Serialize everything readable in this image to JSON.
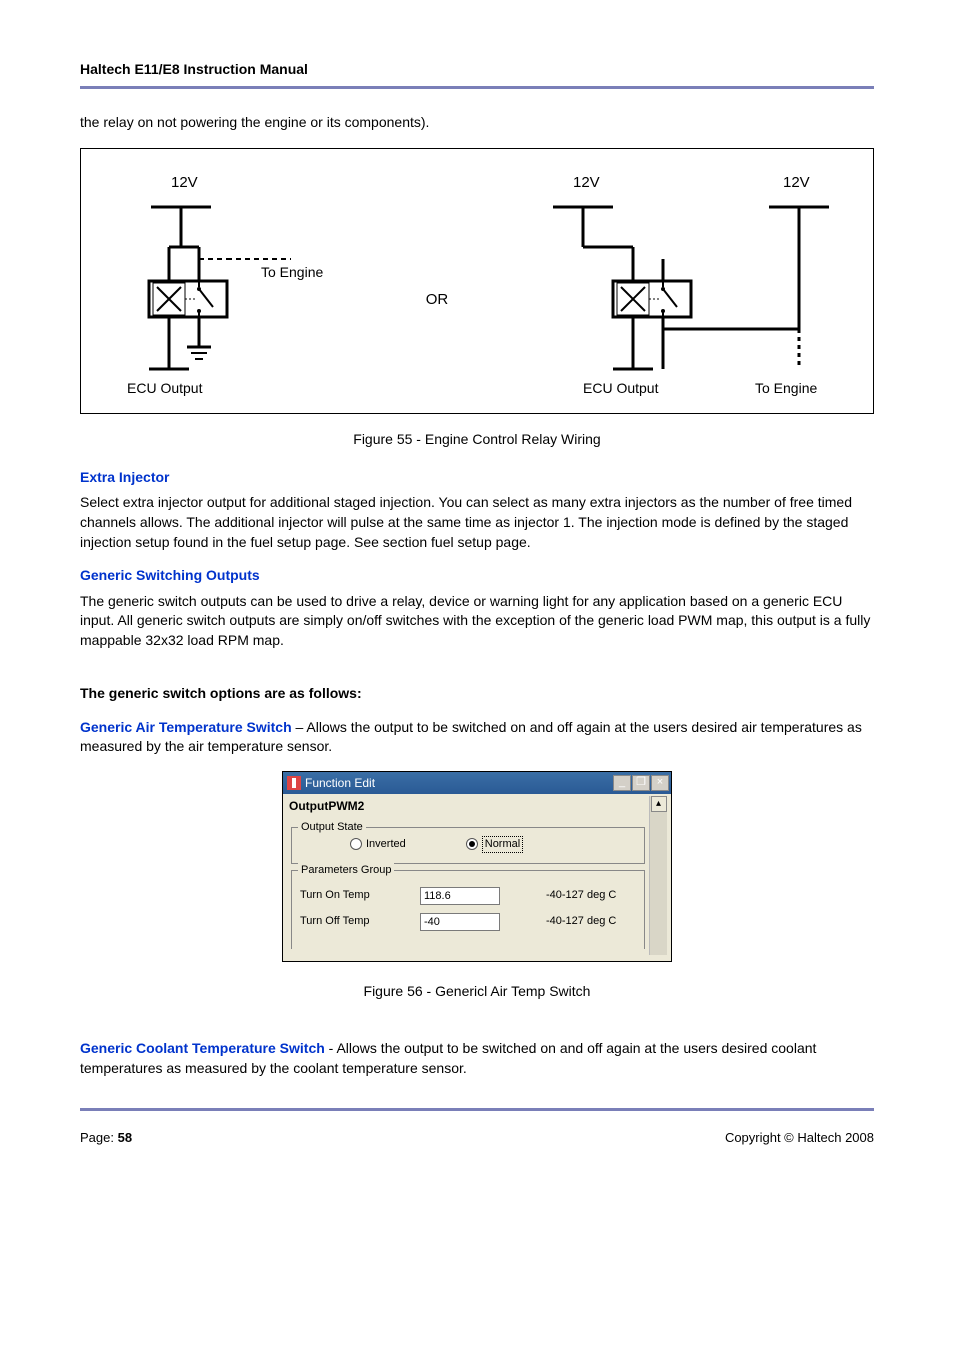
{
  "header": {
    "title": "Haltech E11/E8 Instruction Manual"
  },
  "intro_cont": "the relay on not powering the engine or its components).",
  "diagram": {
    "v12_a": "12V",
    "v12_b": "12V",
    "v12_c": "12V",
    "to_engine": "To Engine",
    "or": "OR",
    "ecu_out_a": "ECU Output",
    "ecu_out_b": "ECU Output",
    "to_engine_b": "To Engine"
  },
  "fig55": "Figure 55 - Engine Control Relay Wiring",
  "extra_injector": {
    "heading": "Extra Injector",
    "text": "Select extra injector output for additional staged injection. You can select as many extra injectors as the number of free timed channels allows. The additional injector will pulse at the same time as injector 1. The injection mode is defined by the staged injection setup found in the fuel setup page. See section  fuel setup page."
  },
  "generic_switching": {
    "heading": "Generic Switching Outputs",
    "text": "The generic switch outputs can be used to drive a relay, device or warning light for any application based on a generic ECU input. All generic switch outputs are simply on/off switches with the exception of the generic load PWM map, this output is a fully mappable 32x32 load RPM map."
  },
  "options_intro": "The generic switch options are as follows:",
  "generic_air": {
    "heading": "Generic Air Temperature Switch",
    "text": " – Allows the output to be switched on and off again at the users desired air temperatures as measured by the air temperature sensor."
  },
  "dialog": {
    "title": "Function Edit",
    "min": "_",
    "restore": "❐",
    "close": "×",
    "subheader": "OutputPWM2",
    "scroll_up": "▴",
    "output_state": {
      "legend": "Output State",
      "inverted": "Inverted",
      "normal": "Normal",
      "selected": "normal"
    },
    "params": {
      "legend": "Parameters Group",
      "rows": [
        {
          "label": "Turn On Temp",
          "value": "118.6",
          "range": "-40-127 deg C"
        },
        {
          "label": "Turn Off Temp",
          "value": "-40",
          "range": "-40-127 deg C"
        }
      ]
    }
  },
  "fig56": "Figure 56 - Genericl Air Temp Switch",
  "generic_coolant": {
    "heading": "Generic Coolant Temperature Switch",
    "text": " - Allows the output to be switched on and off again at the users desired coolant temperatures as measured by the coolant temperature sensor."
  },
  "footer": {
    "page_label": "Page: ",
    "page_num": "58",
    "copyright": "Copyright © Haltech 2008"
  }
}
